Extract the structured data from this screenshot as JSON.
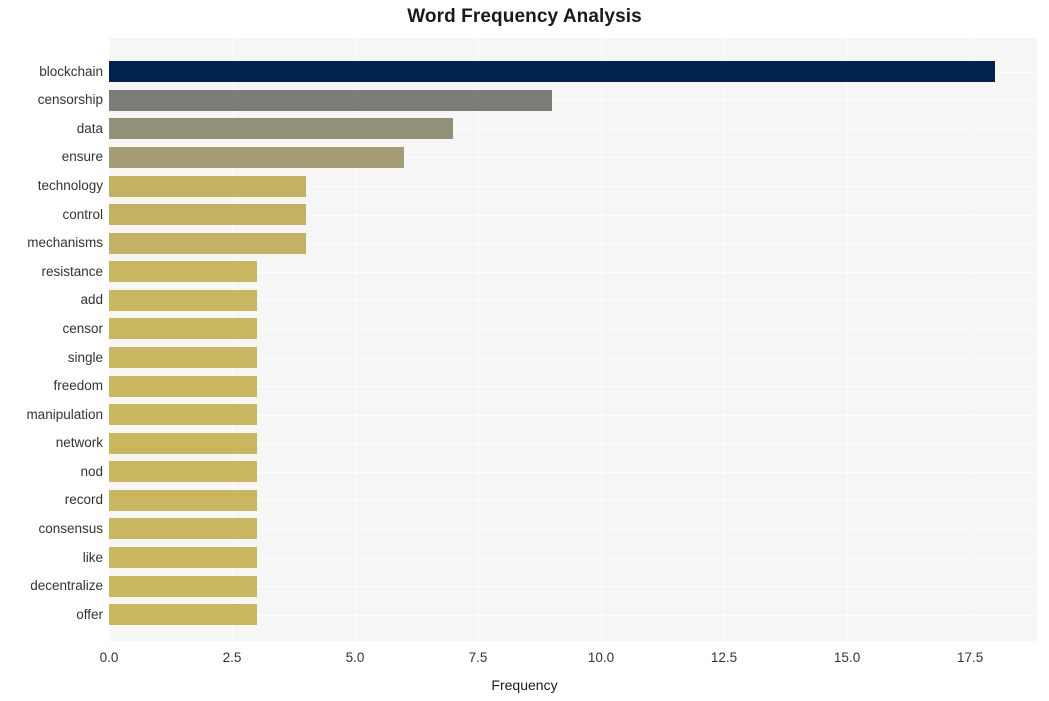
{
  "chart_data": {
    "type": "bar",
    "orientation": "horizontal",
    "title": "Word Frequency Analysis",
    "xlabel": "Frequency",
    "ylabel": "",
    "categories": [
      "blockchain",
      "censorship",
      "data",
      "ensure",
      "technology",
      "control",
      "mechanisms",
      "resistance",
      "add",
      "censor",
      "single",
      "freedom",
      "manipulation",
      "network",
      "nod",
      "record",
      "consensus",
      "like",
      "decentralize",
      "offer"
    ],
    "values": [
      18,
      9,
      7,
      6,
      4,
      4,
      4,
      3,
      3,
      3,
      3,
      3,
      3,
      3,
      3,
      3,
      3,
      3,
      3,
      3
    ],
    "bar_colors": [
      "#002350",
      "#7d7d78",
      "#93907a",
      "#a49c75",
      "#c4b263",
      "#c4b263",
      "#c3b164",
      "#c9b75f",
      "#c9b75f",
      "#c9b75f",
      "#c9b75f",
      "#c9b75f",
      "#c9b75f",
      "#c9b75f",
      "#c9b75f",
      "#c9b75f",
      "#c9b75f",
      "#c9b75f",
      "#c9b75f",
      "#c9b75f"
    ],
    "xticks": [
      "0.0",
      "2.5",
      "5.0",
      "7.5",
      "10.0",
      "12.5",
      "15.0",
      "17.5"
    ],
    "xtick_values": [
      0.0,
      2.5,
      5.0,
      7.5,
      10.0,
      12.5,
      15.0,
      17.5
    ],
    "xlim": [
      0,
      18.86
    ],
    "grid": true,
    "grid_color": "#fcfcfc",
    "plot_background": "#f6f6f6",
    "figure_background": "#ffffff",
    "legend": null
  }
}
